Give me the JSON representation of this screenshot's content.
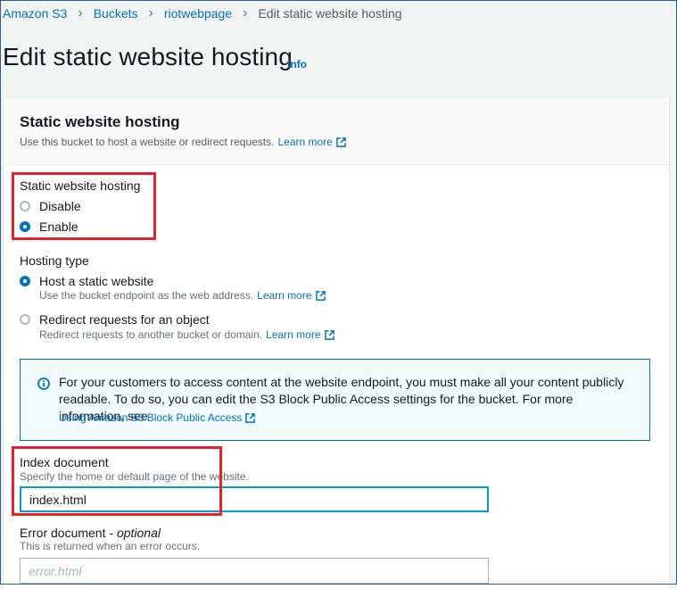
{
  "breadcrumb": {
    "items": [
      "Amazon S3",
      "Buckets",
      "riotwebpage"
    ],
    "current": "Edit static website hosting"
  },
  "page": {
    "title": "Edit static website hosting",
    "info": "Info"
  },
  "panel": {
    "title": "Static website hosting",
    "description": "Use this bucket to host a website or redirect requests.",
    "learn_more": "Learn more"
  },
  "hosting": {
    "label": "Static website hosting",
    "options": [
      "Disable",
      "Enable"
    ],
    "selected": "Enable"
  },
  "hosting_type": {
    "label": "Hosting type",
    "options": [
      {
        "label": "Host a static website",
        "desc": "Use the bucket endpoint as the web address.",
        "link": "Learn more"
      },
      {
        "label": "Redirect requests for an object",
        "desc": "Redirect requests to another bucket or domain.",
        "link": "Learn more"
      }
    ],
    "selected": "Host a static website"
  },
  "alert": {
    "text": "For your customers to access content at the website endpoint, you must make all your content publicly readable. To do so, you can edit the S3 Block Public Access settings for the bucket. For more information, see",
    "link": "Using Amazon S3 Block Public Access"
  },
  "index_document": {
    "label": "Index document",
    "desc": "Specify the home or default page of the website.",
    "value": "index.html"
  },
  "error_document": {
    "label": "Error document - ",
    "optional": "optional",
    "desc": "This is returned when an error occurs.",
    "placeholder": "error.html",
    "value": ""
  },
  "colors": {
    "link": "#0073bb",
    "highlight": "#e0232c",
    "focus": "#00a1c9"
  }
}
